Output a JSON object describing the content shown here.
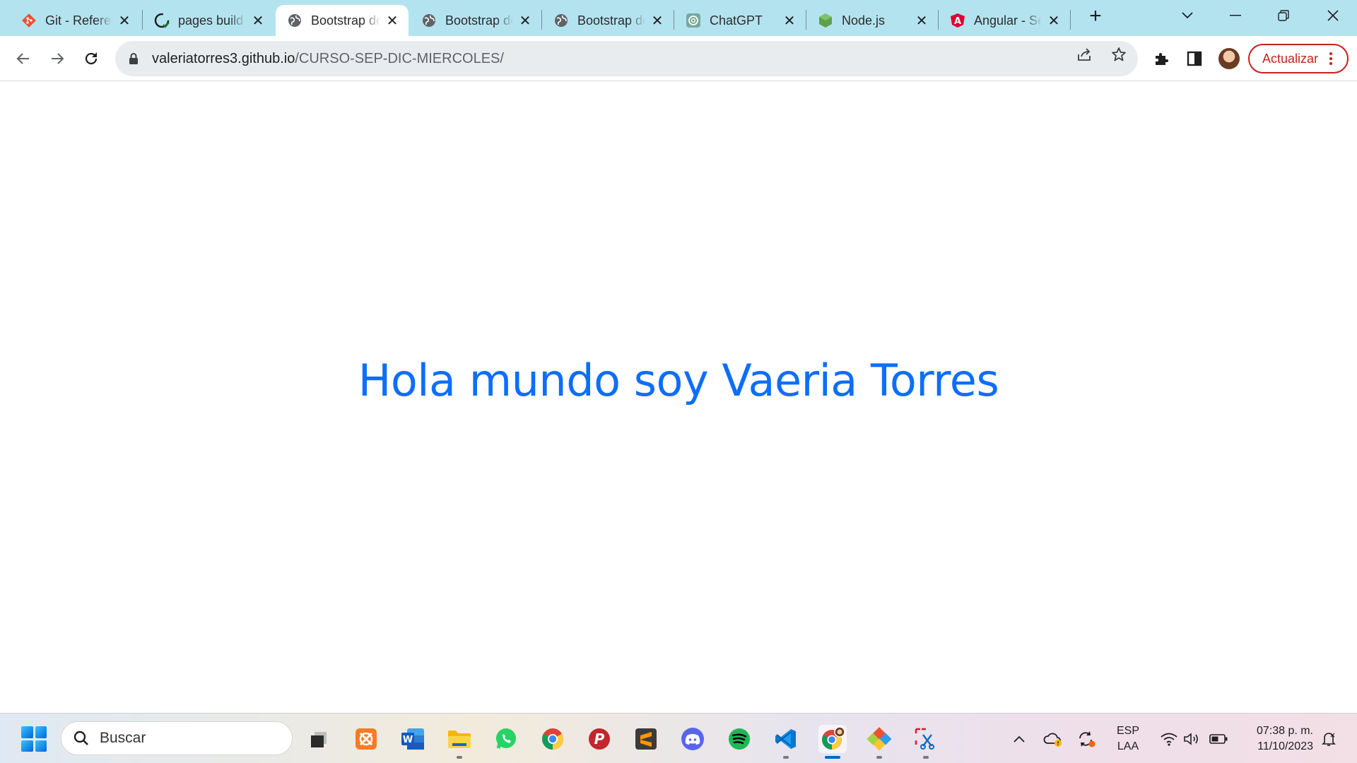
{
  "browser": {
    "tabs": [
      {
        "title": "Git - Reference",
        "favicon": "git-icon",
        "active": false
      },
      {
        "title": "pages build and deployment",
        "favicon": "github-icon",
        "active": false
      },
      {
        "title": "Bootstrap demo",
        "favicon": "globe-icon",
        "active": true
      },
      {
        "title": "Bootstrap demo",
        "favicon": "globe-icon",
        "active": false
      },
      {
        "title": "Bootstrap demo",
        "favicon": "globe-icon",
        "active": false
      },
      {
        "title": "ChatGPT",
        "favicon": "chatgpt-icon",
        "active": false
      },
      {
        "title": "Node.js",
        "favicon": "nodejs-icon",
        "active": false
      },
      {
        "title": "Angular - Setup",
        "favicon": "angular-icon",
        "active": false
      }
    ],
    "address": {
      "domain": "valeriatorres3.github.io",
      "path": "/CURSO-SEP-DIC-MIERCOLES/"
    },
    "update_label": "Actualizar",
    "colors": {
      "tabstrip": "#b4e3f0",
      "update": "#c5221f"
    }
  },
  "page": {
    "heading": "Hola mundo soy Vaeria Torres",
    "heading_color": "#0d6efd"
  },
  "taskbar": {
    "search_placeholder": "Buscar",
    "apps": [
      "file-explorer-icon",
      "xampp-icon",
      "word-icon",
      "folder-icon",
      "whatsapp-icon",
      "chrome-icon",
      "postman-icon",
      "sublime-text-icon",
      "discord-icon",
      "spotify-icon",
      "vscode-icon",
      "chrome-profile-icon",
      "git-gui-icon",
      "snipping-tool-icon"
    ],
    "language_top": "ESP",
    "language_bottom": "LAA",
    "time": "07:38 p. m.",
    "date": "11/10/2023"
  }
}
